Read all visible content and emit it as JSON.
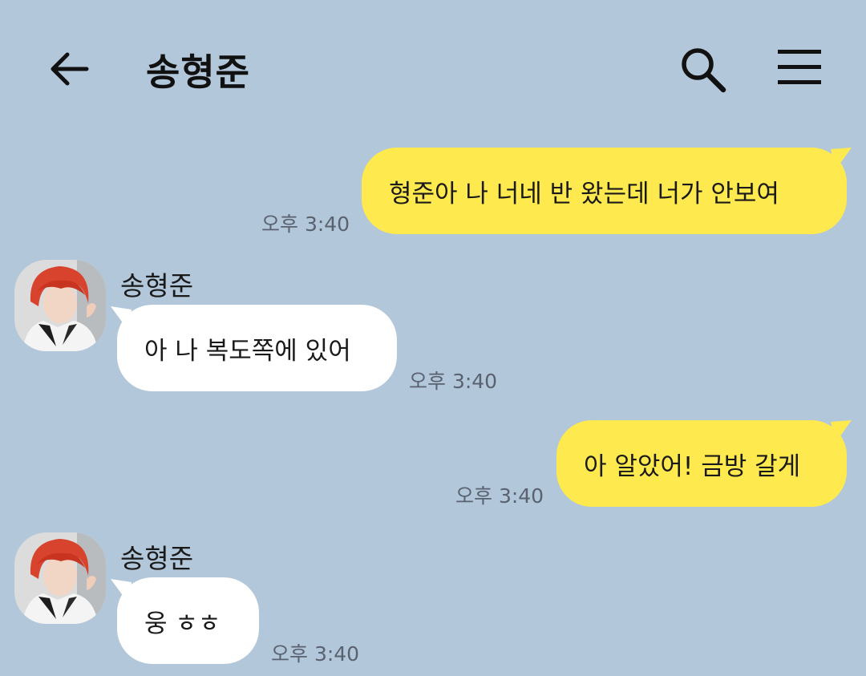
{
  "header": {
    "title": "송형준",
    "back_icon": "arrow-left-icon",
    "search_icon": "search-icon",
    "menu_icon": "menu-icon"
  },
  "colors": {
    "background": "#b2c7da",
    "my_bubble": "#fee94e",
    "their_bubble": "#ffffff"
  },
  "messages": [
    {
      "sender": "me",
      "text": "형준아 나 너네 반 왔는데 너가 안보여",
      "time": "오후 3:40"
    },
    {
      "sender": "송형준",
      "text": "아 나 복도쪽에 있어",
      "time": "오후 3:40"
    },
    {
      "sender": "me",
      "text": "아 알았어! 금방 갈게",
      "time": "오후 3:40"
    },
    {
      "sender": "송형준",
      "text": "웅 ㅎㅎ",
      "time": "오후 3:40"
    }
  ]
}
